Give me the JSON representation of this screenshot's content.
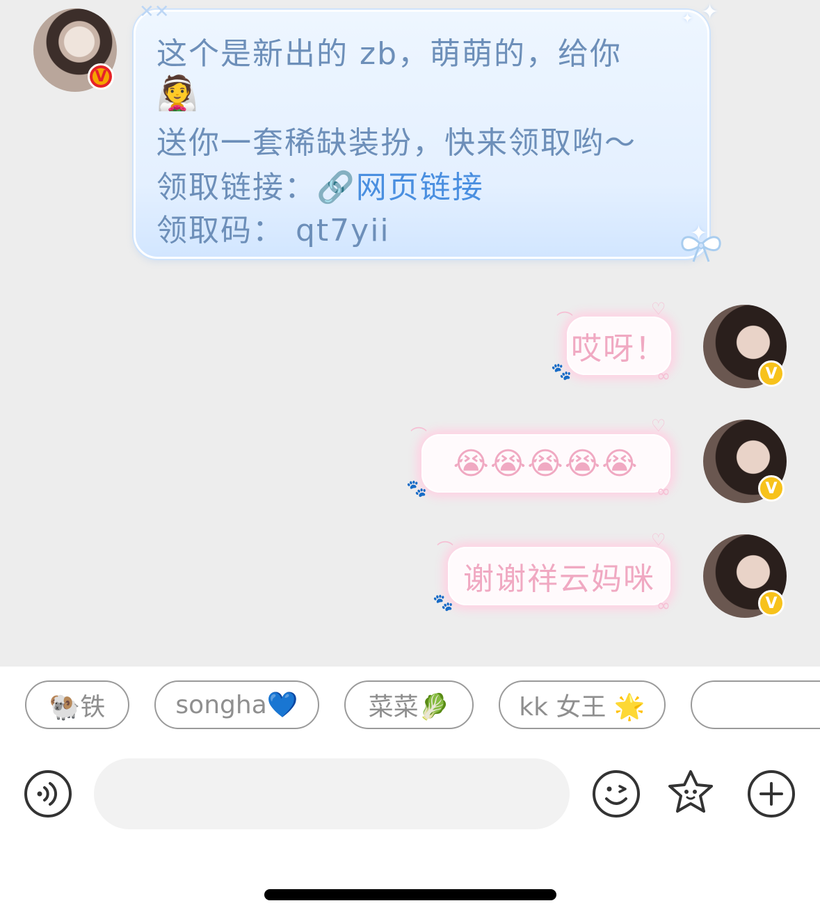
{
  "messages": {
    "incoming": {
      "line1": "这个是新出的 zb，萌萌的，给你",
      "line2_emoji": "👰",
      "line3": "送你一套稀缺装扮，快来领取哟～",
      "line4_label": "领取链接：",
      "line4_link": "🔗网页链接",
      "line5": "领取码：  qt7yii"
    },
    "outgoing": [
      {
        "text": "哎呀！"
      },
      {
        "text": "😭😭😭😭😭"
      },
      {
        "text": "谢谢祥云妈咪"
      }
    ],
    "badge_letter": "V"
  },
  "quick_replies": [
    {
      "label": "🐏铁"
    },
    {
      "label": "songha💙"
    },
    {
      "label": "菜菜🥬"
    },
    {
      "label": "kk 女王 🌟"
    },
    {
      "label": ""
    }
  ],
  "input": {
    "placeholder": ""
  },
  "icons": {
    "voice": "voice-icon",
    "emoji": "smiley-wink-icon",
    "sticker": "star-face-icon",
    "more": "plus-circle-icon"
  },
  "colors": {
    "incoming_text": "#6d8fb9",
    "link": "#4a8fe0",
    "outgoing_text": "#f0a9c2"
  }
}
